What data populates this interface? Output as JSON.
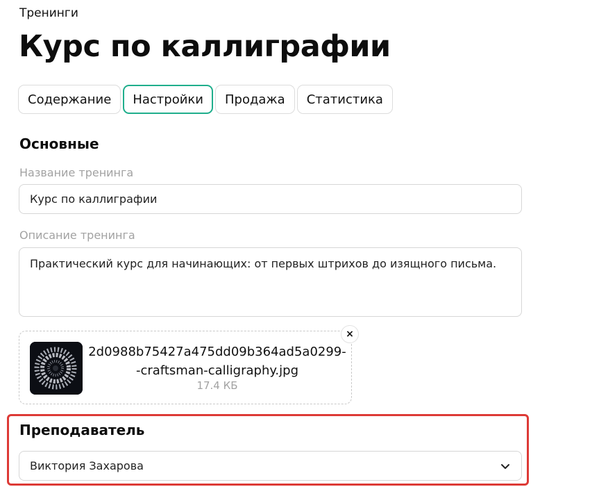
{
  "breadcrumb": "Тренинги",
  "page_title": "Курс по каллиграфии",
  "tabs": [
    {
      "label": "Содержание",
      "active": false
    },
    {
      "label": "Настройки",
      "active": true
    },
    {
      "label": "Продажа",
      "active": false
    },
    {
      "label": "Статистика",
      "active": false
    }
  ],
  "basic_section": {
    "title": "Основные",
    "name_label": "Название тренинга",
    "name_value": "Курс по каллиграфии",
    "description_label": "Описание тренинга",
    "description_value": "Практический курс для начинающих: от первых штрихов до изящного письма."
  },
  "upload": {
    "file_name_line1": "2d0988b75427a475dd09b364ad5a0299-",
    "file_name_line2": "-craftsman-calligraphy.jpg",
    "file_size": "17.4 КБ",
    "remove_symbol": "×",
    "thumbnail_icon": "image-thumbnail"
  },
  "teacher_section": {
    "title": "Преподаватель",
    "selected": "Виктория Захарова",
    "dropdown_icon": "chevron-down-icon"
  },
  "colors": {
    "accent": "#1fae8c",
    "highlight": "#dd3a36",
    "muted_text": "#a2a2a2",
    "border": "#d6d6d6"
  }
}
